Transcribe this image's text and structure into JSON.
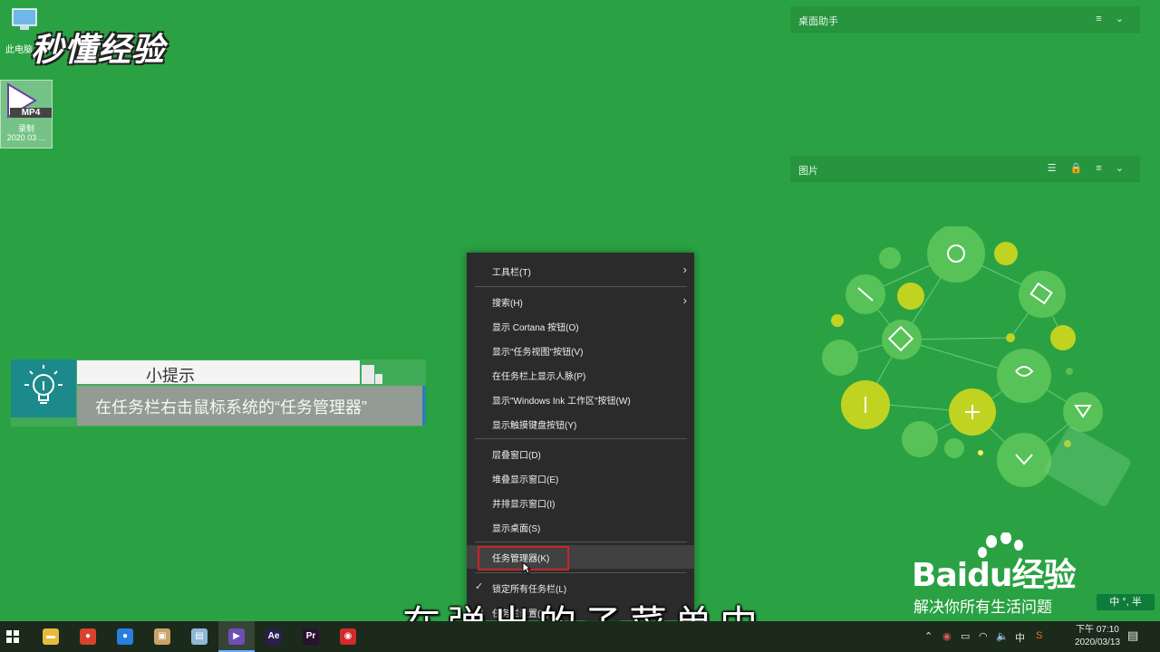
{
  "watermark": {
    "brand": "秒懂经验",
    "pc_label": "此电脑"
  },
  "desktop_file": {
    "badge": "MP4",
    "name_line1": "录制",
    "name_line2": "2020 03 ..."
  },
  "widgets": [
    {
      "title": "桌面助手",
      "controls": "≡ ⌄"
    },
    {
      "title": "图片",
      "controls": "☰ 🔒 ≡ ⌄"
    }
  ],
  "context_menu": {
    "items": [
      {
        "label": "工具栏(T)",
        "submenu": true
      },
      {
        "label": "搜索(H)",
        "submenu": true
      },
      {
        "label": "显示 Cortana 按钮(O)"
      },
      {
        "label": "显示\"任务视图\"按钮(V)"
      },
      {
        "label": "在任务栏上显示人脉(P)"
      },
      {
        "label": "显示\"Windows Ink 工作区\"按钮(W)"
      },
      {
        "label": "显示触摸键盘按钮(Y)"
      },
      {
        "label": "层叠窗口(D)"
      },
      {
        "label": "堆叠显示窗口(E)"
      },
      {
        "label": "并排显示窗口(I)"
      },
      {
        "label": "显示桌面(S)"
      },
      {
        "label": "任务管理器(K)",
        "highlighted": true
      },
      {
        "label": "锁定所有任务栏(L)",
        "checked": true
      },
      {
        "label": "任务栏设置(T)"
      }
    ]
  },
  "tip": {
    "title": "小提示",
    "body": "在任务栏右击鼠标系统的“任务管理器”"
  },
  "baidu": {
    "logo": "Baidu经验",
    "slogan": "解决你所有生活问题",
    "badge": "中 °, 半"
  },
  "subtitle": "在弹出的子菜单中",
  "taskbar": {
    "apps": [
      {
        "name": "file-explorer-icon",
        "glyph": "▬",
        "color": "#e8b93a"
      },
      {
        "name": "chrome-icon",
        "glyph": "●",
        "color": "#d9412f"
      },
      {
        "name": "browser-icon",
        "glyph": "●",
        "color": "#2a7de1"
      },
      {
        "name": "photos-icon",
        "glyph": "▣",
        "color": "#c9a36a"
      },
      {
        "name": "notes-icon",
        "glyph": "▤",
        "color": "#8fb8d6"
      },
      {
        "name": "vs-icon",
        "glyph": "▶",
        "color": "#6c4fb5"
      },
      {
        "name": "after-effects-icon",
        "glyph": "Ae",
        "color": "#2a1f4c"
      },
      {
        "name": "premiere-icon",
        "glyph": "Pr",
        "color": "#2b1030"
      },
      {
        "name": "netease-music-icon",
        "glyph": "◉",
        "color": "#d12b2b"
      }
    ],
    "tray": {
      "ime": "中",
      "time": "下午 07:10",
      "date": "2020/03/13"
    }
  }
}
